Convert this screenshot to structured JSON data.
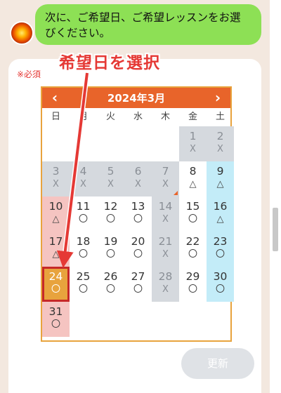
{
  "chat": {
    "message": "次に、ご希望日、ご希望レッスンをお選びください。"
  },
  "form": {
    "required_label": "※必須",
    "update_button": "更新"
  },
  "annotation": {
    "text": "希望日を選択",
    "color": "#e53935"
  },
  "calendar": {
    "title": "2024年3月",
    "prev_icon": "chevron-left-icon",
    "next_icon": "chevron-right-icon",
    "weekdays": [
      "日",
      "月",
      "火",
      "水",
      "木",
      "金",
      "土"
    ],
    "days": [
      {
        "day": "1",
        "mark": "X",
        "state": "gray"
      },
      {
        "day": "2",
        "mark": "X",
        "state": "gray"
      },
      {
        "day": "3",
        "mark": "X",
        "state": "gray"
      },
      {
        "day": "4",
        "mark": "X",
        "state": "gray"
      },
      {
        "day": "5",
        "mark": "X",
        "state": "gray"
      },
      {
        "day": "6",
        "mark": "X",
        "state": "gray"
      },
      {
        "day": "7",
        "mark": "X",
        "state": "gray",
        "flag": true
      },
      {
        "day": "8",
        "mark": "△",
        "state": "normal"
      },
      {
        "day": "9",
        "mark": "△",
        "state": "sat"
      },
      {
        "day": "10",
        "mark": "△",
        "state": "sun"
      },
      {
        "day": "11",
        "mark": "〇",
        "state": "normal"
      },
      {
        "day": "12",
        "mark": "〇",
        "state": "normal"
      },
      {
        "day": "13",
        "mark": "〇",
        "state": "normal"
      },
      {
        "day": "14",
        "mark": "X",
        "state": "gray"
      },
      {
        "day": "15",
        "mark": "〇",
        "state": "normal"
      },
      {
        "day": "16",
        "mark": "△",
        "state": "sat"
      },
      {
        "day": "17",
        "mark": "△",
        "state": "sun"
      },
      {
        "day": "18",
        "mark": "〇",
        "state": "normal"
      },
      {
        "day": "19",
        "mark": "〇",
        "state": "normal"
      },
      {
        "day": "20",
        "mark": "〇",
        "state": "normal"
      },
      {
        "day": "21",
        "mark": "X",
        "state": "gray"
      },
      {
        "day": "22",
        "mark": "〇",
        "state": "normal"
      },
      {
        "day": "23",
        "mark": "〇",
        "state": "sat"
      },
      {
        "day": "24",
        "mark": "〇",
        "state": "selected"
      },
      {
        "day": "25",
        "mark": "〇",
        "state": "normal"
      },
      {
        "day": "26",
        "mark": "〇",
        "state": "normal"
      },
      {
        "day": "27",
        "mark": "〇",
        "state": "normal"
      },
      {
        "day": "28",
        "mark": "X",
        "state": "gray"
      },
      {
        "day": "29",
        "mark": "〇",
        "state": "normal"
      },
      {
        "day": "30",
        "mark": "〇",
        "state": "sat"
      },
      {
        "day": "31",
        "mark": "〇",
        "state": "sun"
      }
    ],
    "colors": {
      "header": "#e8642a",
      "border": "#e8a33d",
      "closed": "#d5d9de",
      "saturday": "#c3ecf8",
      "sunday": "#f5c4c1",
      "selected_outline": "#c62828"
    }
  }
}
